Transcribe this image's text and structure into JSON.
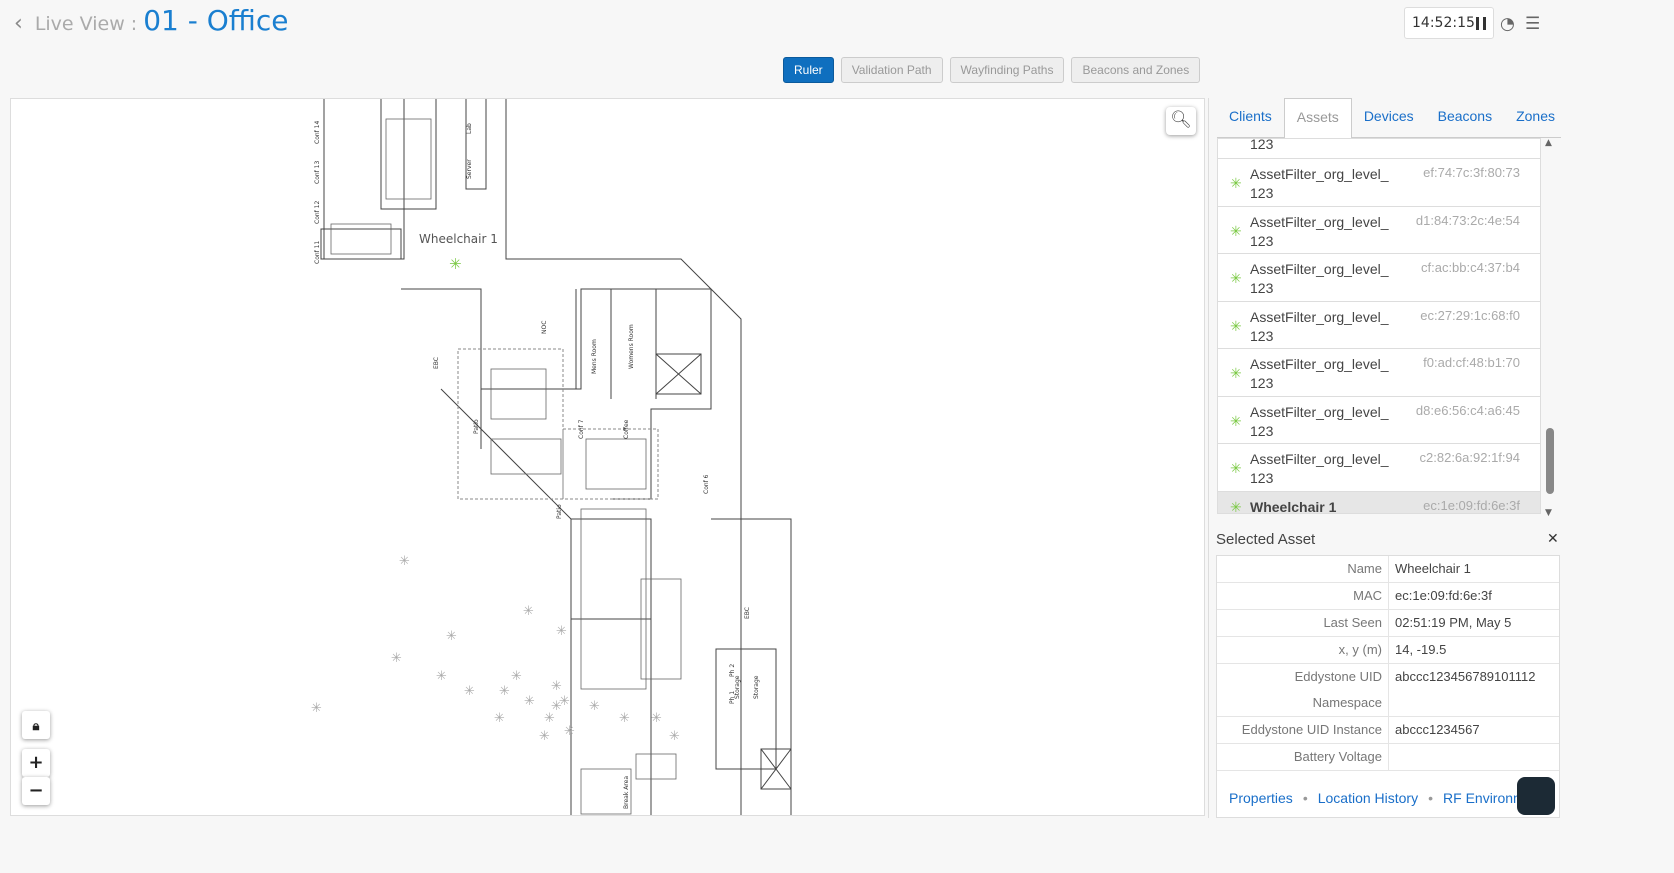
{
  "header": {
    "back_icon": "chevron-left-icon",
    "prefix": "Live View :",
    "title": "01 - Office",
    "clock": "14:52:15"
  },
  "toolbar": {
    "buttons": [
      "Ruler",
      "Validation Path",
      "Wayfinding Paths",
      "Beacons and Zones"
    ]
  },
  "map": {
    "asset_label": "Wheelchair 1",
    "rooms": [
      "Conf 14",
      "Conf 13",
      "Conf 12",
      "Conf 11",
      "Lab",
      "Server",
      "EBC",
      "NOC",
      "Mens Room",
      "Womens Room",
      "Patio",
      "Conf 7",
      "Coffee",
      "Conf 6",
      "Patio",
      "EBC",
      "Storage",
      "Break Area",
      "Storage",
      "Ph 2",
      "Ph 1"
    ]
  },
  "tabs": [
    "Clients",
    "Assets",
    "Devices",
    "Beacons",
    "Zones"
  ],
  "assets": {
    "partial": "123",
    "items": [
      {
        "name": "AssetFilter_org_level_ 123",
        "mac": "ef:74:7c:3f:80:73"
      },
      {
        "name": "AssetFilter_org_level_ 123",
        "mac": "d1:84:73:2c:4e:54"
      },
      {
        "name": "AssetFilter_org_level_ 123",
        "mac": "cf:ac:bb:c4:37:b4"
      },
      {
        "name": "AssetFilter_org_level_ 123",
        "mac": "ec:27:29:1c:68:f0"
      },
      {
        "name": "AssetFilter_org_level_ 123",
        "mac": "f0:ad:cf:48:b1:70"
      },
      {
        "name": "AssetFilter_org_level_ 123",
        "mac": "d8:e6:56:c4:a6:45"
      },
      {
        "name": "AssetFilter_org_level_ 123",
        "mac": "c2:82:6a:92:1f:94"
      },
      {
        "name": "Wheelchair 1",
        "mac": "ec:1e:09:fd:6e:3f"
      }
    ]
  },
  "selected": {
    "title": "Selected Asset",
    "rows": [
      {
        "k": "Name",
        "v": "Wheelchair 1"
      },
      {
        "k": "MAC",
        "v": "ec:1e:09:fd:6e:3f"
      },
      {
        "k": "Last Seen",
        "v": "02:51:19 PM, May 5"
      },
      {
        "k": "x, y (m)",
        "v": "14, -19.5"
      },
      {
        "k": "Eddystone UID Namespace",
        "v": "abccc123456789101112"
      },
      {
        "k": "Eddystone UID Instance",
        "v": "abccc1234567"
      },
      {
        "k": "Battery Voltage",
        "v": ""
      }
    ]
  },
  "links": [
    "Properties",
    "Location History",
    "RF Environment"
  ],
  "colors": {
    "accent": "#1a7fd0",
    "bluetooth": "#7ac943"
  }
}
